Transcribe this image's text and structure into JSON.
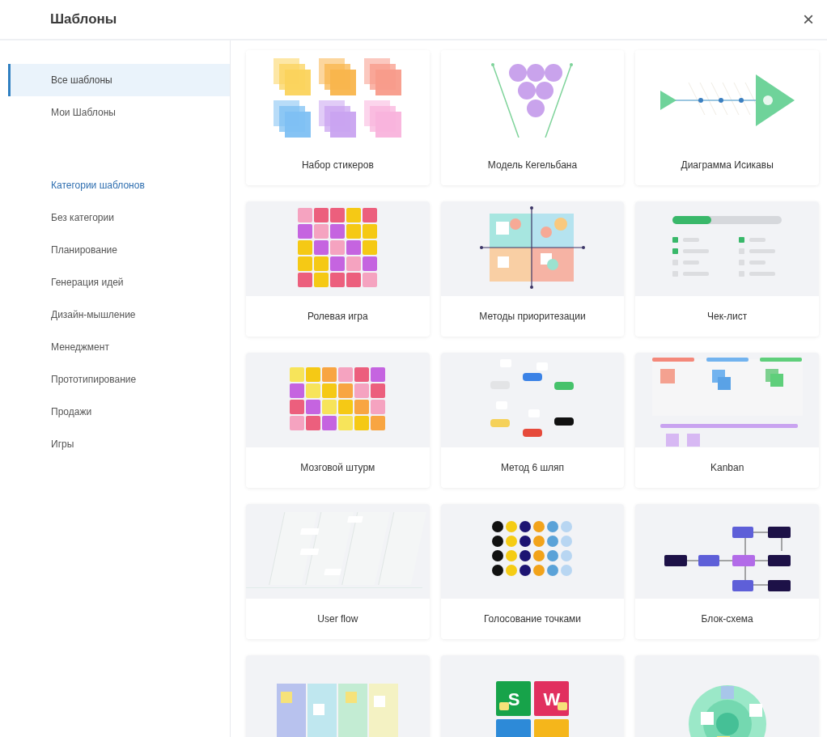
{
  "window": {
    "title": "Шаблоны",
    "close": "×"
  },
  "sidebar": {
    "items": [
      {
        "label": "Все шаблоны",
        "selected": true
      },
      {
        "label": "Мои Шаблоны",
        "selected": false
      }
    ],
    "categories_heading": "Категории шаблонов",
    "categories": [
      {
        "label": "Без категории",
        "selected": false
      },
      {
        "label": "Планирование",
        "selected": false
      },
      {
        "label": "Генерация идей",
        "selected": false
      },
      {
        "label": "Дизайн-мышление",
        "selected": false
      },
      {
        "label": "Менеджмент",
        "selected": false
      },
      {
        "label": "Прототипирование",
        "selected": false
      },
      {
        "label": "Продажи",
        "selected": false
      },
      {
        "label": "Игры",
        "selected": false
      }
    ]
  },
  "templates": [
    {
      "kind": "stickers",
      "title": "Набор стикеров"
    },
    {
      "kind": "bowling",
      "title": "Модель Кегельбана"
    },
    {
      "kind": "fishbone",
      "title": "Диаграмма Исикавы"
    },
    {
      "kind": "roleplay",
      "title": "Ролевая игра"
    },
    {
      "kind": "priority",
      "title": "Методы приоритезации"
    },
    {
      "kind": "checklist",
      "title": "Чек-лист"
    },
    {
      "kind": "brainstorm",
      "title": "Мозговой штурм"
    },
    {
      "kind": "hats",
      "title": "Метод 6 шляп"
    },
    {
      "kind": "kanban",
      "title": "Kanban"
    },
    {
      "kind": "userflow",
      "title": "User flow"
    },
    {
      "kind": "dots",
      "title": "Голосование точками"
    },
    {
      "kind": "flowchart",
      "title": "Блок-схема"
    },
    {
      "kind": "columns"
    },
    {
      "kind": "swot",
      "preview_letters": [
        "S",
        "W"
      ]
    },
    {
      "kind": "circle"
    }
  ]
}
